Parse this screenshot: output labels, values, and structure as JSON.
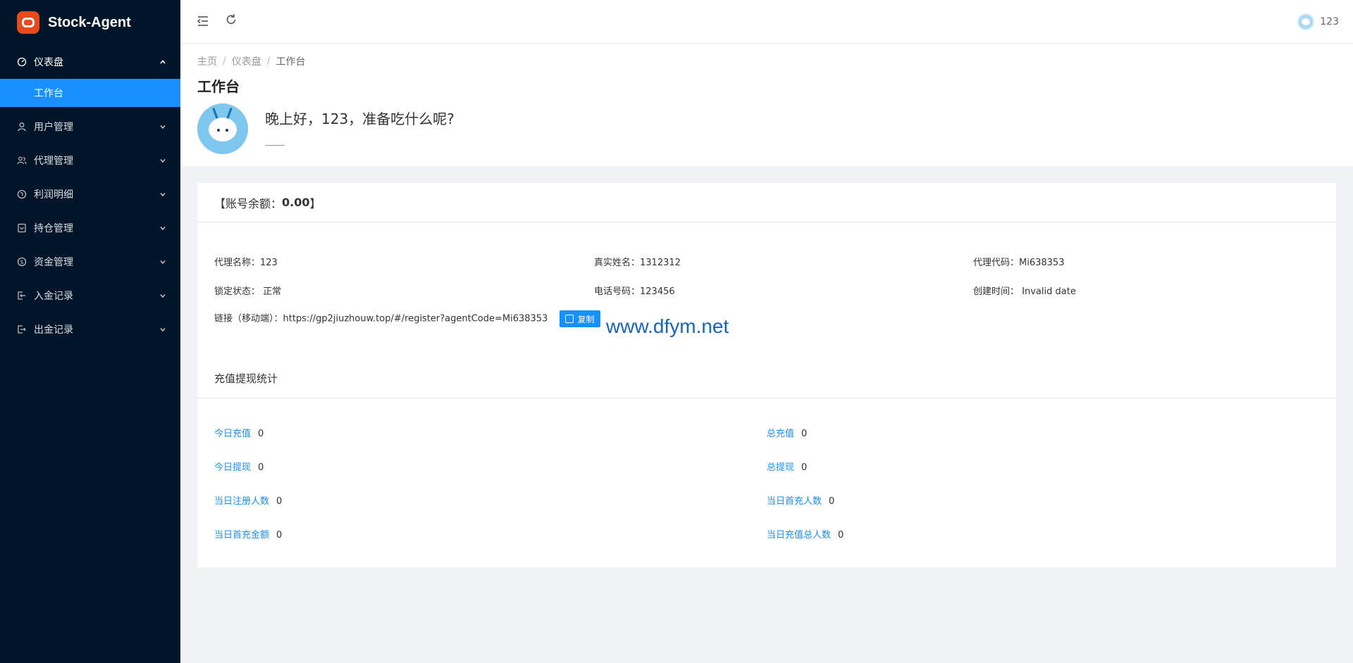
{
  "brand": {
    "name": "Stock-Agent"
  },
  "sidebar": {
    "items": [
      {
        "label": "仪表盘",
        "icon": "dashboard-icon",
        "open": true
      },
      {
        "label": "用户管理",
        "icon": "user-icon"
      },
      {
        "label": "代理管理",
        "icon": "team-icon"
      },
      {
        "label": "利润明细",
        "icon": "profit-icon"
      },
      {
        "label": "持仓管理",
        "icon": "position-icon"
      },
      {
        "label": "资金管理",
        "icon": "dollar-icon"
      },
      {
        "label": "入金记录",
        "icon": "login-icon"
      },
      {
        "label": "出金记录",
        "icon": "logout-icon"
      }
    ],
    "sub_item": "工作台"
  },
  "header": {
    "username": "123"
  },
  "breadcrumb": [
    "主页",
    "仪表盘",
    "工作台"
  ],
  "page_title": "工作台",
  "welcome": {
    "greeting": "晚上好，123，准备吃什么呢?"
  },
  "account": {
    "balance_prefix": "【账号余额：",
    "balance": "0.00",
    "balance_suffix": "】",
    "agent_name_label": "代理名称：",
    "agent_name": "123",
    "real_name_label": "真实姓名：",
    "real_name": "1312312",
    "agent_code_label": "代理代码：",
    "agent_code": "Mi638353",
    "lock_label": "锁定状态：",
    "lock_value": "正常",
    "phone_label": "电话号码：",
    "phone": "123456",
    "created_label": "创建时间：",
    "created": "Invalid date",
    "link_label": "链接（移动端）：",
    "link": "https://gp2jiuzhouw.top/#/register?agentCode=Mi638353",
    "copy_label": "复制"
  },
  "watermark": "www.dfym.net",
  "stats": {
    "title": "充值提现统计",
    "today_recharge_label": "今日充值",
    "today_recharge": "0",
    "total_recharge_label": "总充值",
    "total_recharge": "0",
    "today_withdraw_label": "今日提现",
    "today_withdraw": "0",
    "total_withdraw_label": "总提现",
    "total_withdraw": "0",
    "today_register_label": "当日注册人数",
    "today_register": "0",
    "today_first_recharge_count_label": "当日首充人数",
    "today_first_recharge_count": "0",
    "today_first_recharge_amount_label": "当日首充金额",
    "today_first_recharge_amount": "0",
    "today_recharge_users_label": "当日充值总人数",
    "today_recharge_users": "0"
  },
  "colors": {
    "sidebar": "#001529",
    "accent": "#1890ff",
    "brand": "#e8491d"
  }
}
